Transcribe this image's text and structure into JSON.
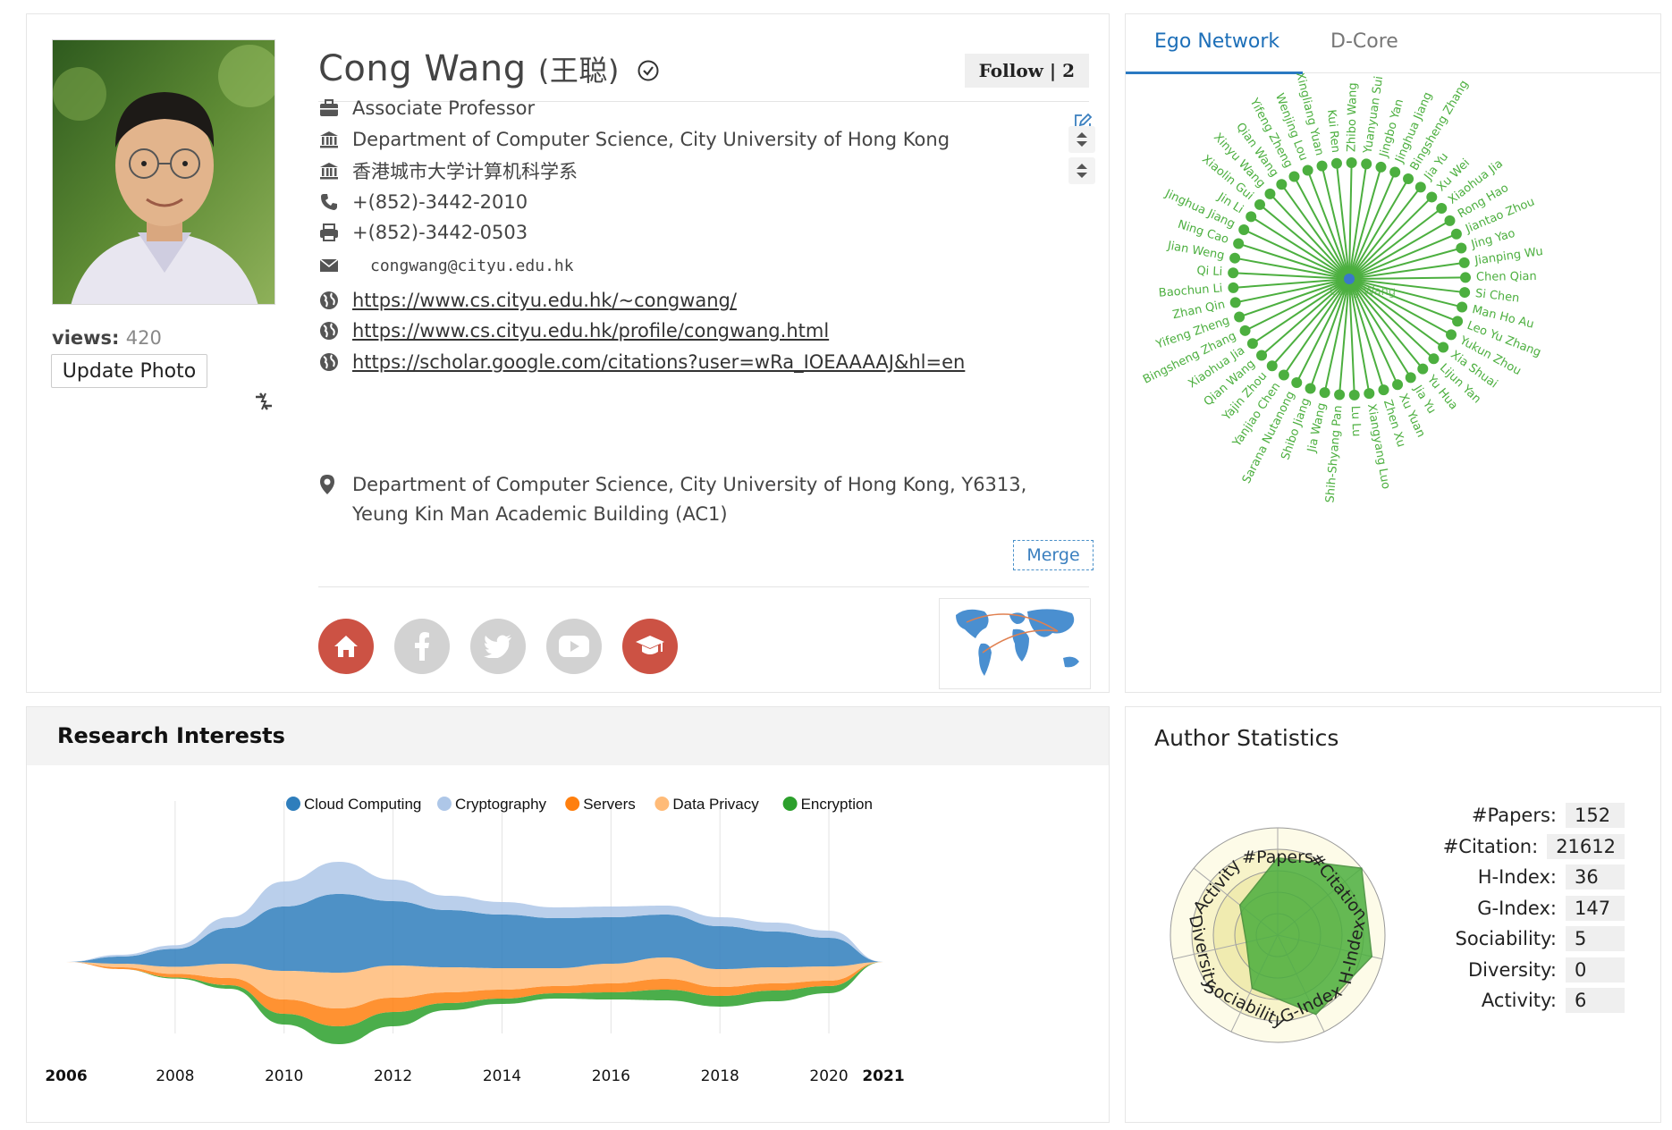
{
  "profile": {
    "name": "Cong Wang",
    "name_cn": "(王聪)",
    "follow_label": "Follow | 2",
    "views_label": "views:",
    "views_count": "420",
    "update_photo_label": "Update Photo",
    "position": "Associate Professor",
    "affiliation": "Department of Computer Science, City University of Hong Kong",
    "affiliation_cn": "香港城市大学计算机科学系",
    "phone": "+(852)-3442-2010",
    "fax": "+(852)-3442-0503",
    "email": "congwang@cityu.edu.hk",
    "links": [
      "https://www.cs.cityu.edu.hk/~congwang/",
      "https://www.cs.cityu.edu.hk/profile/congwang.html",
      "https://scholar.google.com/citations?user=wRa_IOEAAAAJ&hl=en"
    ],
    "address": "Department of Computer Science, City University of Hong Kong, Y6313, Yeung Kin Man Academic Building (AC1)",
    "merge_label": "Merge",
    "social_icons": [
      "home-icon",
      "facebook-icon",
      "twitter-icon",
      "youtube-icon",
      "graduation-cap-icon"
    ],
    "social_colors": {
      "active": "#cc5244",
      "inactive": "#d2d2d2"
    }
  },
  "network": {
    "tabs": [
      "Ego Network",
      "D-Core"
    ],
    "center": "Cong Wang",
    "nodes": [
      "Zhibo Wang",
      "Yuanyuan Sui",
      "Jingbo Yan",
      "Jinghua Jiang",
      "Bingsheng Zhang",
      "Jia Yu",
      "Xu Wei",
      "Xiaohua Jia",
      "Rong Hao",
      "Jiantao Zhou",
      "Jing Yao",
      "Jianping Wu",
      "Chen Qian",
      "Si Chen",
      "Man Ho Au",
      "Leo Yu Zhang",
      "Yukun Zhou",
      "Xia Shuai",
      "Lijun Yan",
      "Yu Hua",
      "Jia Yu",
      "Xu Yuan",
      "Zhen Xu",
      "Xiangyang Luo",
      "Lu Lu",
      "Shih-Shyang Pan",
      "Jia Wang",
      "Shibo Jiang",
      "Sarana Nutanong",
      "Yanjiao Chen",
      "Yajin Zhou",
      "Qian Wang",
      "Xiaohua Jia",
      "Bingsheng Zhang",
      "Yifeng Zheng",
      "Zhan Qin",
      "Baochun Li",
      "Qi Li",
      "Jian Weng",
      "Ning Cao",
      "Jinghua Jiang",
      "Jin Li",
      "Xiaolin Gui",
      "Xinyu Wang",
      "Qian Wang",
      "Yifeng Zheng",
      "Wenjing Lou",
      "Xingliang Yuan",
      "Kui Ren"
    ],
    "color": "#4caf3f",
    "center_color": "#3a78c9"
  },
  "interests": {
    "title": "Research Interests",
    "chart_data": {
      "type": "area",
      "x": [
        2006,
        2007,
        2008,
        2009,
        2010,
        2011,
        2012,
        2013,
        2014,
        2015,
        2016,
        2017,
        2018,
        2019,
        2020,
        2021
      ],
      "tick_labels": [
        "2006",
        "2008",
        "2010",
        "2012",
        "2014",
        "2016",
        "2018",
        "2020",
        "2021"
      ],
      "series": [
        {
          "name": "Cloud Computing",
          "color": "#2f7ebc",
          "values": [
            0,
            2,
            5,
            10,
            18,
            22,
            18,
            16,
            15,
            14,
            13,
            12,
            12,
            10,
            8,
            0
          ]
        },
        {
          "name": "Cryptography",
          "color": "#aec7e8",
          "values": [
            0,
            0.5,
            1,
            3,
            7,
            9,
            6,
            4,
            3.5,
            3,
            3,
            2.5,
            2.5,
            2.5,
            2,
            0
          ]
        },
        {
          "name": "Servers",
          "color": "#ff7f0e",
          "values": [
            0,
            0.5,
            1,
            2,
            4,
            5,
            4,
            3,
            2.5,
            2,
            2.5,
            3,
            2.5,
            2,
            1.5,
            0
          ]
        },
        {
          "name": "Data Privacy",
          "color": "#ffbb78",
          "values": [
            0,
            1,
            2,
            4,
            8,
            10,
            9,
            7,
            6,
            5,
            5.5,
            6,
            5,
            4.5,
            4,
            0
          ]
        },
        {
          "name": "Encryption",
          "color": "#2ca02c",
          "values": [
            0,
            0,
            0.3,
            1,
            3,
            5,
            4,
            2,
            1.5,
            1.5,
            2,
            3,
            3,
            3,
            2,
            0
          ]
        }
      ]
    }
  },
  "stats": {
    "title": "Author Statistics",
    "rows": [
      {
        "label": "#Papers:",
        "value": "152"
      },
      {
        "label": "#Citation:",
        "value": "21612"
      },
      {
        "label": "H-Index:",
        "value": "36"
      },
      {
        "label": "G-Index:",
        "value": "147"
      },
      {
        "label": "Sociability:",
        "value": "5"
      },
      {
        "label": "Diversity:",
        "value": "0"
      },
      {
        "label": "Activity:",
        "value": "6"
      }
    ],
    "chart_data": {
      "type": "radar",
      "axes": [
        "#Papers",
        "#Citation",
        "H-Index",
        "G-Index",
        "Sociability",
        "Diversity",
        "Activity"
      ],
      "values": [
        0.72,
        1.0,
        0.9,
        0.82,
        0.55,
        0.3,
        0.45
      ],
      "color": "#4caf3f"
    }
  }
}
